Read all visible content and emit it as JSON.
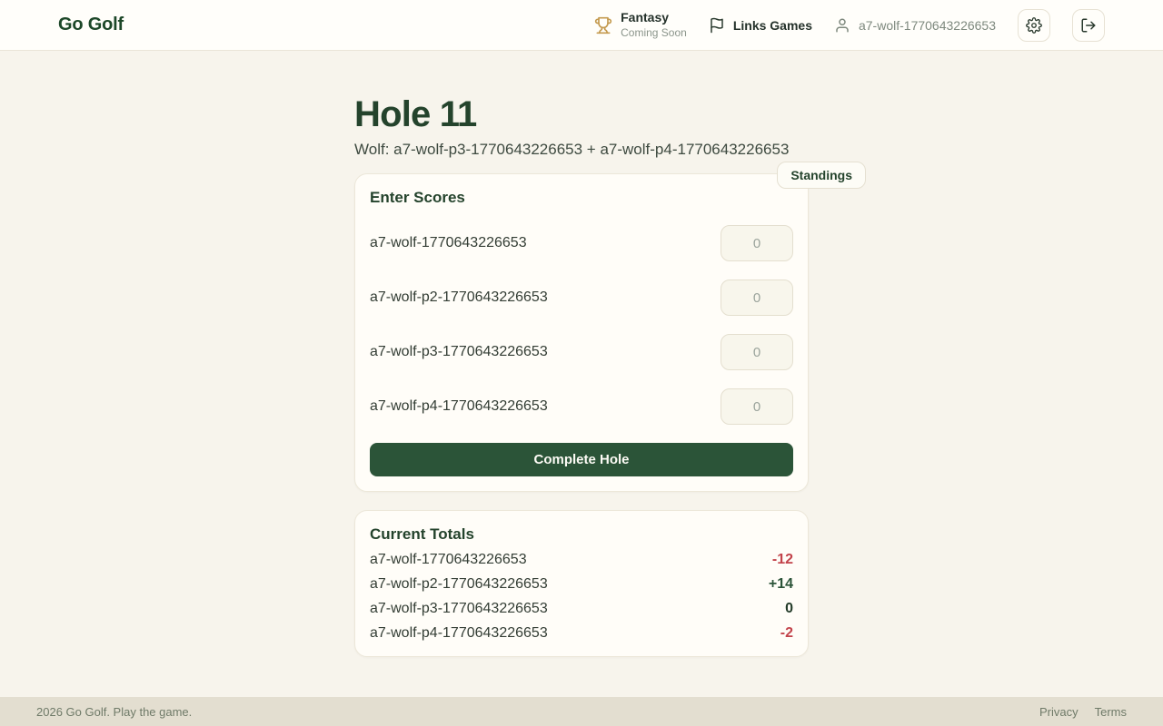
{
  "brand": "Go Golf",
  "nav": {
    "fantasy": {
      "label": "Fantasy",
      "sub": "Coming Soon"
    },
    "links_games_label": "Links Games",
    "username": "a7-wolf-1770643226653"
  },
  "page": {
    "title": "Hole 11",
    "subtitle": "Wolf: a7-wolf-p3-1770643226653 + a7-wolf-p4-1770643226653",
    "standings_label": "Standings"
  },
  "enter_scores": {
    "heading": "Enter Scores",
    "players": [
      {
        "name": "a7-wolf-1770643226653",
        "placeholder": "0",
        "value": ""
      },
      {
        "name": "a7-wolf-p2-1770643226653",
        "placeholder": "0",
        "value": ""
      },
      {
        "name": "a7-wolf-p3-1770643226653",
        "placeholder": "0",
        "value": ""
      },
      {
        "name": "a7-wolf-p4-1770643226653",
        "placeholder": "0",
        "value": ""
      }
    ],
    "submit_label": "Complete Hole"
  },
  "totals": {
    "heading": "Current Totals",
    "rows": [
      {
        "name": "a7-wolf-1770643226653",
        "value": "-12",
        "tone": "negative"
      },
      {
        "name": "a7-wolf-p2-1770643226653",
        "value": "+14",
        "tone": "positive"
      },
      {
        "name": "a7-wolf-p3-1770643226653",
        "value": "0",
        "tone": "neutral"
      },
      {
        "name": "a7-wolf-p4-1770643226653",
        "value": "-2",
        "tone": "negative"
      }
    ]
  },
  "footer": {
    "copyright": "2026 Go Golf. Play the game.",
    "links": {
      "privacy": "Privacy",
      "terms": "Terms"
    }
  },
  "icons": {
    "trophy": "trophy-icon",
    "flag": "flag-icon",
    "user": "user-icon",
    "gear": "gear-icon",
    "logout": "logout-icon"
  },
  "colors": {
    "brand_green": "#1c4728",
    "heading_green": "#24432c",
    "button_green": "#2b5438",
    "negative_red": "#c2424a",
    "positive_green": "#2b5338",
    "trophy_amber": "#c49a4e",
    "page_background": "#f7f4ec",
    "footer_background": "#e3ded0"
  }
}
